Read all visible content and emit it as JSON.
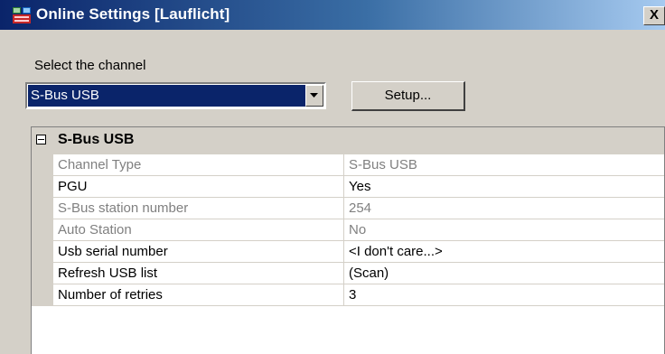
{
  "window": {
    "title": "Online Settings [Lauflicht]",
    "close_label": "X"
  },
  "channel": {
    "label": "Select the channel",
    "selected": "S-Bus USB",
    "setup_label": "Setup..."
  },
  "grid": {
    "group_title": "S-Bus USB",
    "rows": [
      {
        "name": "Channel Type",
        "value": "S-Bus USB",
        "enabled": false
      },
      {
        "name": "PGU",
        "value": "Yes",
        "enabled": true
      },
      {
        "name": "S-Bus station number",
        "value": "254",
        "enabled": false
      },
      {
        "name": "Auto Station",
        "value": "No",
        "enabled": false
      },
      {
        "name": "Usb serial number",
        "value": "<I don't care...>",
        "enabled": true
      },
      {
        "name": "Refresh USB list",
        "value": "(Scan)",
        "enabled": true
      },
      {
        "name": "Number of retries",
        "value": "3",
        "enabled": true
      }
    ]
  },
  "colors": {
    "titlebar_start": "#0a246a",
    "selection": "#0a246a",
    "face": "#d4d0c8",
    "disabled_text": "#808080"
  }
}
